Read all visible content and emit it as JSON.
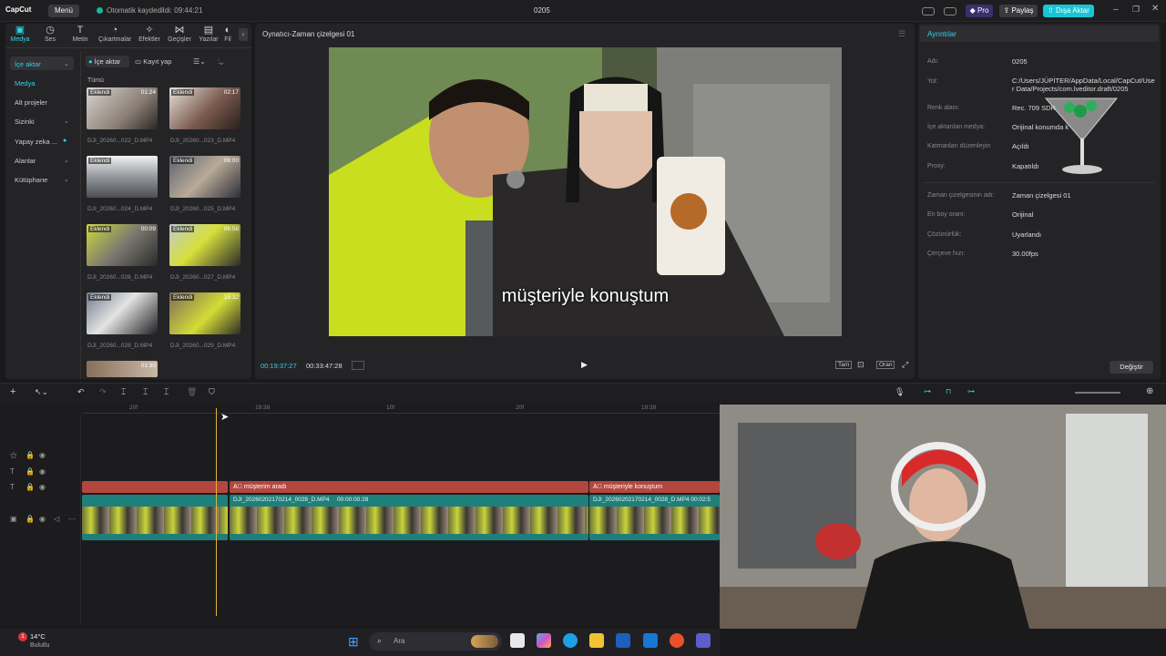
{
  "app": {
    "logo": "CapCut",
    "menu_label": "Menü",
    "autosave": "Otomatik kaydedildi: 09:44:21",
    "project_title": "0205",
    "pro_label": "Pro",
    "share_label": "Paylaş",
    "export_label": "Dışa Aktar"
  },
  "toolbar": {
    "tools": [
      "Medya",
      "Ses",
      "Metin",
      "Çıkartmalar",
      "Efektler",
      "Geçişler",
      "Yazılar",
      "Fil"
    ]
  },
  "sidebar": {
    "items": [
      "İçe aktar",
      "Medya",
      "Alt projeler",
      "Sizinki",
      "Yapay zeka ...",
      "Alanlar",
      "Kütüphane"
    ]
  },
  "media": {
    "import_button": "İçe aktar",
    "record_button": "Kayıt yap",
    "filter_all": "Tümü",
    "clips": [
      {
        "badge": "Eklendi",
        "duration": "01:24",
        "name": "DJI_20260...022_D.MP4"
      },
      {
        "badge": "Eklendi",
        "duration": "02:17",
        "name": "DJI_20260...023_D.MP4"
      },
      {
        "badge": "Eklendi",
        "duration": "",
        "name": "DJI_20260...024_D.MP4"
      },
      {
        "badge": "Eklendi",
        "duration": "06:00",
        "name": "DJI_20260...025_D.MP4"
      },
      {
        "badge": "Eklendi",
        "duration": "00:09",
        "name": "DJI_20260...026_D.MP4"
      },
      {
        "badge": "Eklendi",
        "duration": "06:58",
        "name": "DJI_20260...027_D.MP4"
      },
      {
        "badge": "Eklendi",
        "duration": "",
        "name": "DJI_20260...028_D.MP4"
      },
      {
        "badge": "Eklendi",
        "duration": "15:32",
        "name": "DJI_20260...029_D.MP4"
      },
      {
        "badge": "Eklendi",
        "duration": "01:30",
        "name": ""
      }
    ]
  },
  "player": {
    "title": "Oynatıcı-Zaman çizelgesi 01",
    "subtitle": "müşteriyle konuştum",
    "current_time": "00:19:37:27",
    "total_time": "00:33:47:28",
    "full_label": "Tam",
    "ratio_label": "Oran"
  },
  "details": {
    "header": "Ayrıntılar",
    "rows": [
      {
        "label": "Adı:",
        "value": "0205"
      },
      {
        "label": "Yol:",
        "value": "C:/Users/JÜPİTER/AppData/Local/CapCut/User Data/Projects/com.lveditor.draft/0205"
      },
      {
        "label": "Renk alanı:",
        "value": "Rec. 709 SDR"
      },
      {
        "label": "İçe aktarılan medya:",
        "value": "Orijinal konumda k"
      },
      {
        "label": "Katmanları düzenleyin",
        "value": "Açıldı"
      },
      {
        "label": "Proxy:",
        "value": "Kapatıldı"
      },
      {
        "label": "Zaman çizelgesinin adı:",
        "value": "Zaman çizelgesi 01"
      },
      {
        "label": "En boy oranı:",
        "value": "Orijinal"
      },
      {
        "label": "Çözünürlük:",
        "value": "Uyarlandı"
      },
      {
        "label": "Çerçeve hızı:",
        "value": "30.00fps"
      }
    ],
    "change_button": "Değiştir"
  },
  "timeline": {
    "ruler": [
      "20f",
      "19:38",
      "10f",
      "20f",
      "19:39"
    ],
    "text_clips": [
      "müşterim aradı",
      "müşteriyle konuştum"
    ],
    "video_clip_name": "DJI_20260202170214_0028_D.MP4",
    "video_clip_time": "00:00:00:28",
    "video_clip_name_2": "DJI_20260202170214_0028_D.MP4",
    "video_clip_time_2": "00:02:5"
  },
  "taskbar": {
    "temperature": "14°C",
    "weather": "Bulutlu",
    "search_placeholder": "Ara",
    "notification_count": "1"
  },
  "colors": {
    "accent": "#2fd3e6",
    "text_clip": "#b34740",
    "video_clip": "#1f7f7a",
    "playhead": "#e0b43a",
    "export": "#17c5d6"
  }
}
